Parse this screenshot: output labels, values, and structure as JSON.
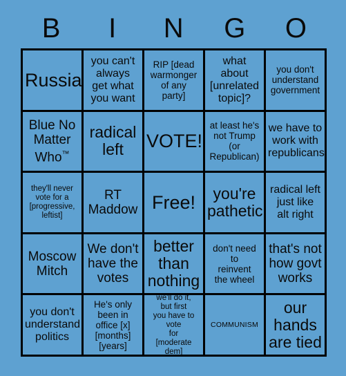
{
  "board": {
    "title": "BINGO",
    "background_color": "#5ea1d1",
    "border_color": "#000000",
    "text_color": "#0a0a0a",
    "header_letters": [
      "B",
      "I",
      "N",
      "G",
      "O"
    ],
    "columns": 5,
    "rows": 5,
    "cells": [
      {
        "text": "Russia",
        "size": "fs-xxl"
      },
      {
        "text": "you can't\nalways\nget what\nyou want",
        "size": "fs-m"
      },
      {
        "text": "RIP [dead\nwarmonger\nof any\nparty]",
        "size": "fs-s"
      },
      {
        "text": "what\nabout\n[unrelated\ntopic]?",
        "size": "fs-m"
      },
      {
        "text": "you don't\nunderstand\ngovernment",
        "size": "fs-s"
      },
      {
        "text": "Blue No\nMatter\nWho",
        "size": "fs-l",
        "trademark": true
      },
      {
        "text": "radical\nleft",
        "size": "fs-xl"
      },
      {
        "text": "VOTE!",
        "size": "fs-xxl"
      },
      {
        "text": "at least he's\nnot Trump\n(or\nRepublican)",
        "size": "fs-s"
      },
      {
        "text": "we have to\nwork with\nrepublicans",
        "size": "fs-m"
      },
      {
        "text": "they'll never\nvote for a\n[progressive,\nleftist]",
        "size": "fs-xs"
      },
      {
        "text": "RT\nMaddow",
        "size": "fs-l"
      },
      {
        "text": "Free!",
        "size": "fs-xxl"
      },
      {
        "text": "you're\npathetic",
        "size": "fs-xl"
      },
      {
        "text": "radical left\njust like\nalt right",
        "size": "fs-m"
      },
      {
        "text": "Moscow\nMitch",
        "size": "fs-l"
      },
      {
        "text": "We don't\nhave the\nvotes",
        "size": "fs-l"
      },
      {
        "text": "better\nthan\nnothing",
        "size": "fs-xl"
      },
      {
        "text": "don't need\nto\nreinvent\nthe wheel",
        "size": "fs-s"
      },
      {
        "text": "that's not\nhow govt\nworks",
        "size": "fs-l"
      },
      {
        "text": "you don't\nunderstand\npolitics",
        "size": "fs-m"
      },
      {
        "text": "He's only\nbeen in\noffice [x]\n[months]\n[years]",
        "size": "fs-s"
      },
      {
        "text": "we'll do it,\nbut first\nyou have to vote\nfor\n[moderate dem]",
        "size": "fs-xs"
      },
      {
        "text": "COMMUNISM",
        "size": "fs-tiny"
      },
      {
        "text": "our\nhands\nare tied",
        "size": "fs-xl"
      }
    ]
  }
}
